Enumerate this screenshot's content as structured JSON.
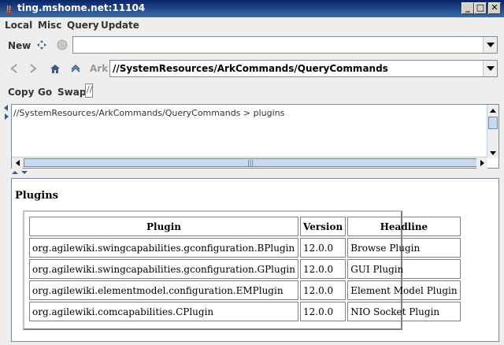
{
  "window": {
    "title": "ting.mshome.net:11104",
    "controls": [
      "_",
      "□",
      "✕"
    ]
  },
  "menu": {
    "items": [
      "Local",
      "Misc",
      "Query",
      "Update"
    ]
  },
  "toolbar1": {
    "new_label": "New",
    "combo_value": ""
  },
  "toolbar2": {
    "ark_label": "Ark",
    "path_value": "//SystemResources/ArkCommands/QueryCommands"
  },
  "toolbar3": {
    "copy_label": "Copy",
    "go_label": "Go",
    "swap_label": "Swap",
    "field_value": "//"
  },
  "upper": {
    "text": "//SystemResources/ArkCommands/QueryCommands > plugins",
    "hscroll_thumb_label": "|||"
  },
  "content": {
    "heading": "Plugins",
    "table": {
      "headers": [
        "Plugin",
        "Version",
        "Headline"
      ],
      "rows": [
        [
          "org.agilewiki.swingcapabilities.gconfiguration.BPlugin",
          "12.0.0",
          "Browse Plugin"
        ],
        [
          "org.agilewiki.swingcapabilities.gconfiguration.GPlugin",
          "12.0.0",
          "GUI Plugin"
        ],
        [
          "org.agilewiki.elementmodel.configuration.EMPlugin",
          "12.0.0",
          "Element Model Plugin"
        ],
        [
          "org.agilewiki.comcapabilities.CPlugin",
          "12.0.0",
          "NIO Socket Plugin"
        ]
      ]
    }
  },
  "colors": {
    "titlebar": "#0a246a",
    "panel": "#eeeeee",
    "border": "#7a8a99"
  }
}
